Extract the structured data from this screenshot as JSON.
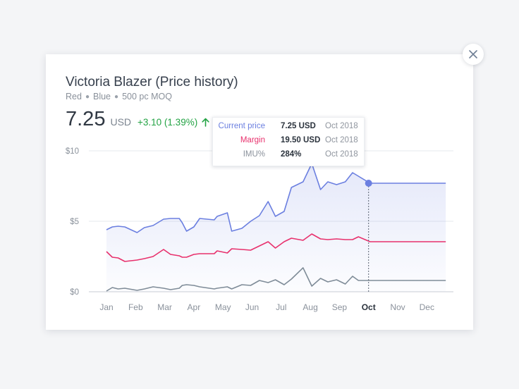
{
  "header": {
    "title": "Victoria Blazer (Price history)",
    "attributes": [
      "Red",
      "Blue",
      "500 pc MOQ"
    ]
  },
  "price": {
    "value": "7.25",
    "currency": "USD",
    "change": "+3.10 (1.39%)"
  },
  "tooltip": {
    "rows": [
      {
        "label": "Current price",
        "value": "7.25 USD",
        "date": "Oct 2018",
        "color": "#6b7fe0"
      },
      {
        "label": "Margin",
        "value": "19.50 USD",
        "date": "Oct 2018",
        "color": "#e8316d"
      },
      {
        "label": "IMU%",
        "value": "284%",
        "date": "Oct 2018",
        "color": "#8a919b"
      }
    ]
  },
  "icons": {
    "close": "close-icon",
    "trend": "arrow-up-icon"
  },
  "colors": {
    "price": "#6b7fe0",
    "margin": "#e8316d",
    "imu": "#7f8c98",
    "positive": "#23a344"
  },
  "chart_data": {
    "type": "line",
    "title": "",
    "xlabel": "",
    "ylabel": "",
    "ylim": [
      0,
      10
    ],
    "yticks": [
      "$0",
      "$5",
      "$10"
    ],
    "xticks": [
      "Jan",
      "Feb",
      "Mar",
      "Apr",
      "May",
      "Jun",
      "Jul",
      "Aug",
      "Sep",
      "Oct",
      "Nov",
      "Dec"
    ],
    "highlighted_tick": "Oct",
    "x": [
      0.0,
      0.2,
      0.4,
      0.63,
      1.05,
      1.3,
      1.6,
      1.96,
      2.2,
      2.5,
      2.6,
      2.75,
      3.0,
      3.2,
      3.7,
      3.8,
      4.15,
      4.3,
      4.65,
      4.95,
      5.25,
      5.55,
      5.8,
      6.1,
      6.35,
      6.75,
      7.05,
      7.35,
      7.6,
      7.9,
      8.2,
      8.45,
      8.65,
      9.05,
      9.2,
      9.6,
      10.0,
      10.2,
      10.6,
      10.95,
      11.3,
      11.65
    ],
    "series": [
      {
        "name": "Current price",
        "values": [
          4.4,
          4.6,
          4.65,
          4.6,
          4.2,
          4.55,
          4.7,
          5.15,
          5.2,
          5.2,
          4.9,
          4.3,
          4.6,
          5.2,
          5.1,
          5.35,
          5.6,
          4.3,
          4.5,
          5.0,
          5.4,
          6.4,
          5.35,
          5.7,
          7.4,
          7.8,
          9.1,
          7.25,
          7.8,
          7.6,
          7.8,
          8.45,
          8.2,
          7.7,
          7.7,
          7.7,
          7.7,
          7.7,
          7.7,
          7.7,
          7.7,
          7.7
        ]
      },
      {
        "name": "Margin",
        "values": [
          2.85,
          2.45,
          2.4,
          2.15,
          2.25,
          2.35,
          2.5,
          3.0,
          2.65,
          2.55,
          2.45,
          2.45,
          2.65,
          2.7,
          2.7,
          2.9,
          2.75,
          3.05,
          3.0,
          2.95,
          3.25,
          3.55,
          3.1,
          3.55,
          3.8,
          3.65,
          4.1,
          3.75,
          3.7,
          3.75,
          3.7,
          3.7,
          3.9,
          3.55,
          3.55,
          3.55,
          3.55,
          3.55,
          3.55,
          3.55,
          3.55,
          3.55
        ]
      },
      {
        "name": "IMU%",
        "values": [
          0.05,
          0.3,
          0.2,
          0.25,
          0.1,
          0.2,
          0.35,
          0.25,
          0.15,
          0.25,
          0.45,
          0.5,
          0.45,
          0.35,
          0.2,
          0.25,
          0.35,
          0.2,
          0.5,
          0.45,
          0.8,
          0.65,
          0.85,
          0.5,
          0.9,
          1.7,
          0.4,
          0.95,
          0.7,
          0.85,
          0.55,
          1.1,
          0.8,
          0.8,
          0.8,
          0.8,
          0.8,
          0.8,
          0.8,
          0.8,
          0.8,
          0.8
        ]
      }
    ]
  }
}
